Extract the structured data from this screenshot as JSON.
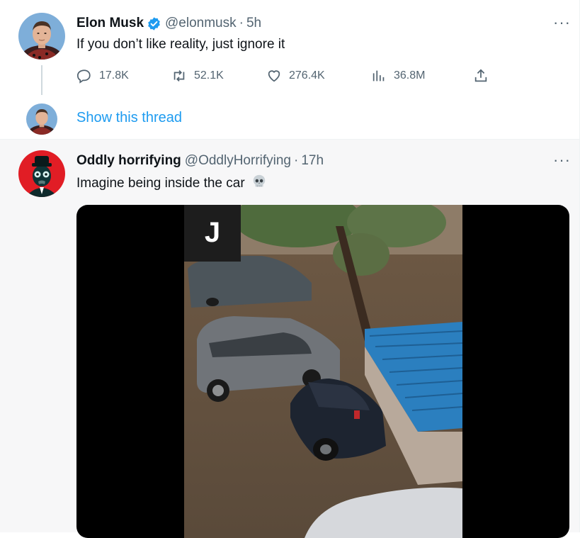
{
  "tweet1": {
    "display_name": "Elon Musk",
    "handle": "@elonmusk",
    "separator": "·",
    "time": "5h",
    "text": "If you don’t like reality, just ignore it",
    "replies": "17.8K",
    "retweets": "52.1K",
    "likes": "276.4K",
    "views": "36.8M",
    "more": "···"
  },
  "thread": {
    "link": "Show this thread"
  },
  "tweet2": {
    "display_name": "Oddly horrifying",
    "handle": "@OddlyHorrifying",
    "separator": "·",
    "time": "17h",
    "text": "Imagine being inside the car",
    "more": "···",
    "video_badge": "J"
  },
  "icons": {
    "reply": "reply-icon",
    "retweet": "retweet-icon",
    "like": "heart-icon",
    "views": "views-icon",
    "share": "share-icon",
    "verified": "verified-badge-icon",
    "skull": "skull-emoji"
  },
  "colors": {
    "accent": "#1d9bf0",
    "muted": "#536471",
    "text": "#0f1419"
  }
}
